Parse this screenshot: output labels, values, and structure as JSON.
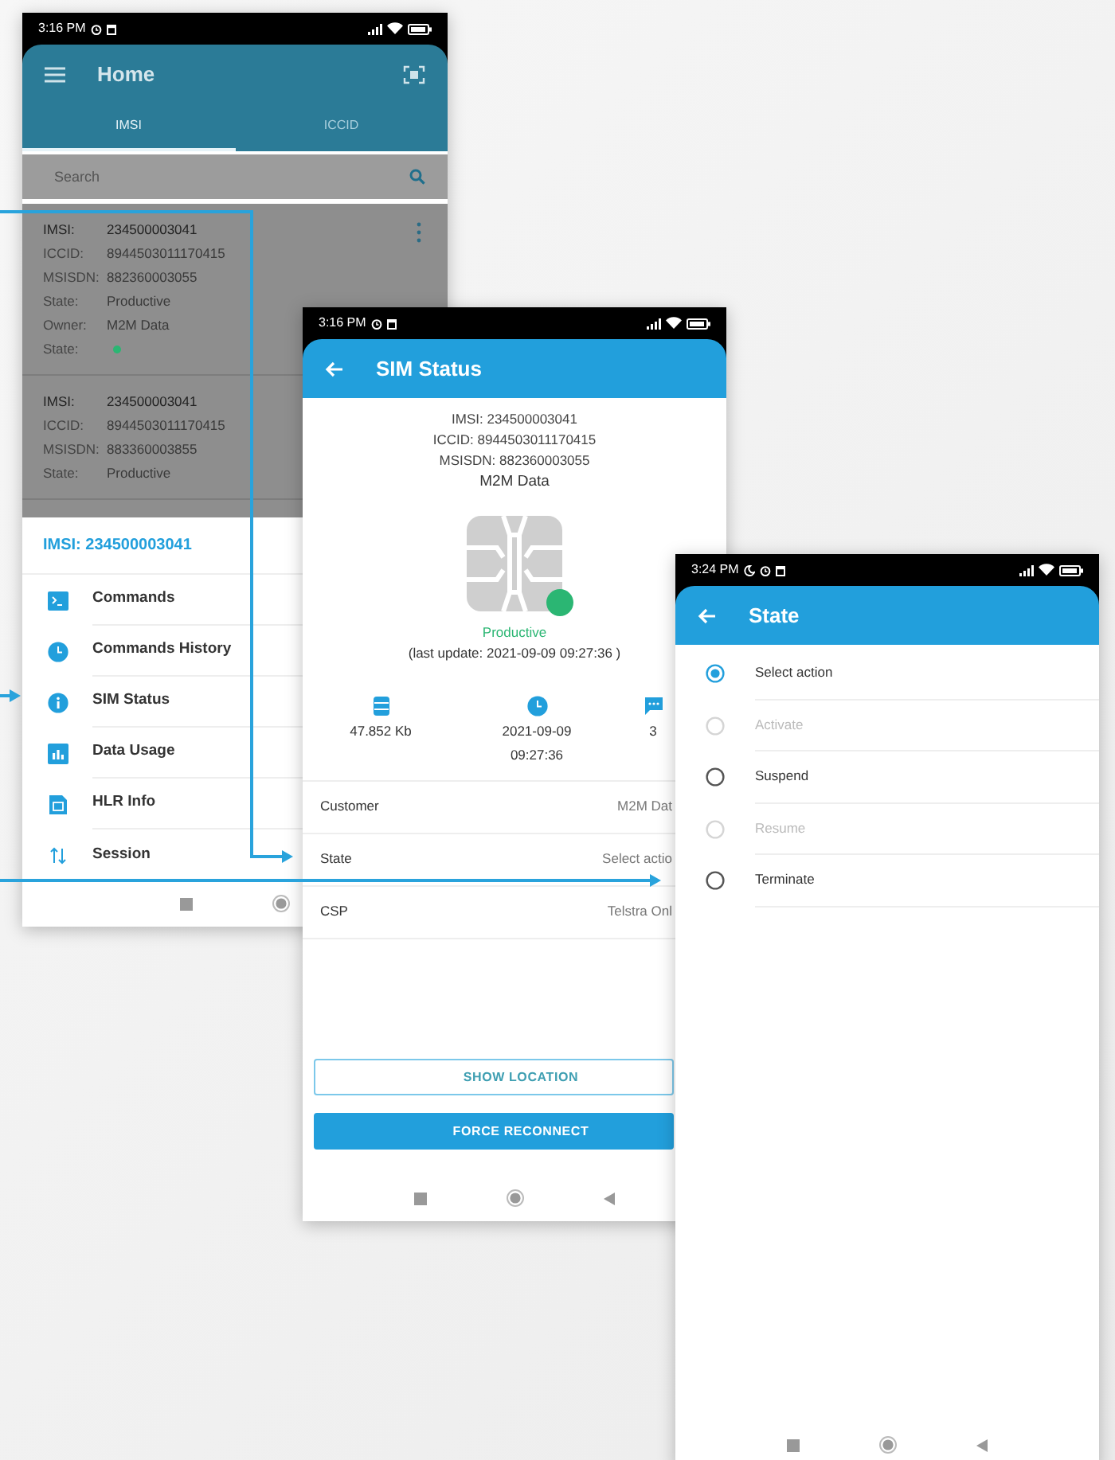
{
  "home": {
    "status_time": "3:16 PM",
    "title": "Home",
    "tabs": [
      {
        "label": "IMSI",
        "selected": true
      },
      {
        "label": "ICCID",
        "selected": false
      }
    ],
    "search": {
      "placeholder": "Search"
    },
    "sims": [
      {
        "fields": [
          {
            "label": "IMSI:",
            "value": "234500003041"
          },
          {
            "label": "ICCID:",
            "value": "8944503011170415"
          },
          {
            "label": "MSISDN:",
            "value": "882360003055"
          },
          {
            "label": "State:",
            "value": "Productive"
          },
          {
            "label": "Owner:",
            "value": "M2M Data"
          },
          {
            "label": "State:",
            "kind": "dot",
            "color": "#2bb673"
          }
        ]
      },
      {
        "fields": [
          {
            "label": "IMSI:",
            "value": "234500003041"
          },
          {
            "label": "ICCID:",
            "value": "8944503011170415"
          },
          {
            "label": "MSISDN:",
            "value": "883360003855"
          },
          {
            "label": "State:",
            "value": "Productive"
          }
        ]
      }
    ],
    "sheet": {
      "title": "IMSI: 234500003041",
      "items": [
        {
          "label": "Commands",
          "kind": "terminal"
        },
        {
          "label": "Commands History",
          "kind": "clock"
        },
        {
          "label": "SIM Status",
          "kind": "info"
        },
        {
          "label": "Data Usage",
          "kind": "chart"
        },
        {
          "label": "HLR Info",
          "kind": "sim"
        },
        {
          "label": "Session",
          "kind": "arrows"
        }
      ]
    }
  },
  "sim_status": {
    "status_time": "3:16 PM",
    "title": "SIM Status",
    "info": [
      "IMSI: 234500003041",
      "ICCID: 8944503011170415",
      "MSISDN: 882360003055"
    ],
    "owner": "M2M Data",
    "state": {
      "label": "Productive",
      "color": "#2bb673"
    },
    "last_update": "(last update: 2021-09-09 09:27:36 )",
    "stats": [
      {
        "kind": "data",
        "lines": [
          "47.852 Kb"
        ]
      },
      {
        "kind": "clock",
        "lines": [
          "2021-09-09",
          "09:27:36"
        ]
      },
      {
        "kind": "sms",
        "lines": [
          "3"
        ]
      }
    ],
    "rows": [
      {
        "label": "Customer",
        "value": "M2M Dat"
      },
      {
        "label": "State",
        "value": "Select actio"
      },
      {
        "label": "CSP",
        "value": "Telstra Onl"
      }
    ],
    "buttons": [
      {
        "label": "SHOW LOCATION",
        "kind": "outline"
      },
      {
        "label": "FORCE RECONNECT",
        "kind": "filled"
      }
    ]
  },
  "state": {
    "status_time": "3:24 PM",
    "title": "State",
    "options": [
      {
        "label": "Select action",
        "selected": true,
        "disabled": false
      },
      {
        "label": "Activate",
        "selected": false,
        "disabled": true
      },
      {
        "label": "Suspend",
        "selected": false,
        "disabled": false
      },
      {
        "label": "Resume",
        "selected": false,
        "disabled": true
      },
      {
        "label": "Terminate",
        "selected": false,
        "disabled": false
      }
    ]
  }
}
